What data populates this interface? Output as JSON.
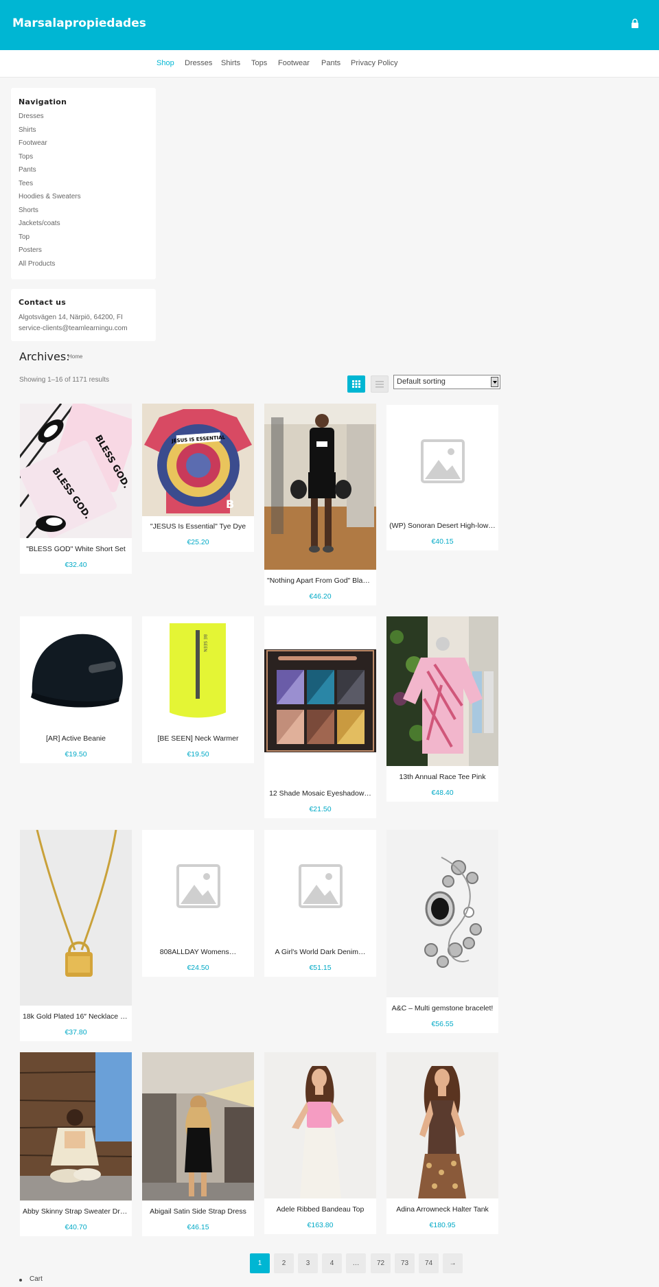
{
  "header": {
    "brand": "Marsalapropiedades",
    "lock_icon": "lock-icon"
  },
  "nav": [
    "Shop",
    "Dresses",
    "Shirts",
    "Tops",
    "Footwear",
    "Pants",
    "Privacy Policy"
  ],
  "sidebar": {
    "navigation_title": "Navigation",
    "links": [
      "Dresses",
      "Shirts",
      "Footwear",
      "Tops",
      "Pants",
      "Tees",
      "Hoodies & Sweaters",
      "Shorts",
      "Jackets/coats",
      "Top",
      "Posters",
      "All Products"
    ],
    "contact_title": "Contact us",
    "address": "Algotsvägen 14, Närpiö, 64200, FI",
    "email": "service-clients@teamlearningu.com"
  },
  "shop": {
    "archives_title": "Archives:",
    "breadcrumb": "Home",
    "result_count": "Showing 1–16 of 1171 results",
    "sorting": "Default sorting",
    "grid_icon": "grid-view-icon",
    "list_icon": "list-view-icon"
  },
  "products": [
    {
      "title": "\"BLESS GOD\" White Short Set",
      "price": "€32.40"
    },
    {
      "title": "\"JESUS Is Essential\" Tye Dye",
      "price": "€25.20"
    },
    {
      "title": "\"Nothing Apart From God\" Black…",
      "price": "€46.20"
    },
    {
      "title": "(WP) Sonoran Desert High-low…",
      "price": "€40.15"
    },
    {
      "title": "[AR] Active Beanie",
      "price": "€19.50"
    },
    {
      "title": "[BE SEEN] Neck Warmer",
      "price": "€19.50"
    },
    {
      "title": "12 Shade Mosaic Eyeshadow…",
      "price": "€21.50"
    },
    {
      "title": "13th Annual Race Tee Pink",
      "price": "€48.40"
    },
    {
      "title": "18k Gold Plated 16″ Necklace w…",
      "price": "€37.80"
    },
    {
      "title": "808ALLDAY Womens…",
      "price": "€24.50"
    },
    {
      "title": "A Girl's World Dark Denim…",
      "price": "€51.15"
    },
    {
      "title": "A&C – Multi gemstone bracelet!",
      "price": "€56.55"
    },
    {
      "title": "Abby Skinny Strap Sweater Dress",
      "price": "€40.70"
    },
    {
      "title": "Abigail Satin Side Strap Dress",
      "price": "€46.15"
    },
    {
      "title": "Adele Ribbed Bandeau Top",
      "price": "€163.80"
    },
    {
      "title": "Adina Arrowneck Halter Tank",
      "price": "€180.95"
    }
  ],
  "image_texts": {
    "bless1": "BLESS GOD.",
    "bless2": "BLESS GOD.",
    "jesus": "JESUS IS ESSENTIAL",
    "beseen": "BE SEEN"
  },
  "pagination": [
    "1",
    "2",
    "3",
    "4",
    "…",
    "72",
    "73",
    "74",
    "→"
  ],
  "footer": {
    "cart": "Cart"
  },
  "colors": {
    "accent": "#00b6d3",
    "price": "#00a9c6"
  }
}
